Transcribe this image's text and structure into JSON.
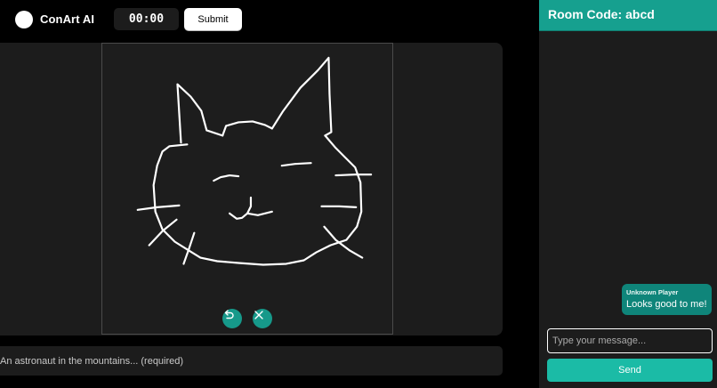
{
  "header": {
    "brand": "ConArt AI",
    "timer": "00:00",
    "submit_label": "Submit"
  },
  "canvas": {
    "drawing_subject": "cat-face-sketch",
    "stroke_color": "#ffffff",
    "tools": [
      {
        "name": "undo",
        "icon": "undo-arrow-icon",
        "color": "#16998a"
      },
      {
        "name": "clear",
        "icon": "close-x-icon",
        "color": "#16998a"
      }
    ]
  },
  "prompt": {
    "placeholder": "An astronaut in the mountains... (required)",
    "value": ""
  },
  "chat": {
    "room_code_label": "Room Code: abcd",
    "accent_color": "#16a08f",
    "messages": [
      {
        "author": "Unknown Player",
        "text": "Looks good to me!"
      }
    ],
    "input_placeholder": "Type your message...",
    "send_label": "Send"
  }
}
